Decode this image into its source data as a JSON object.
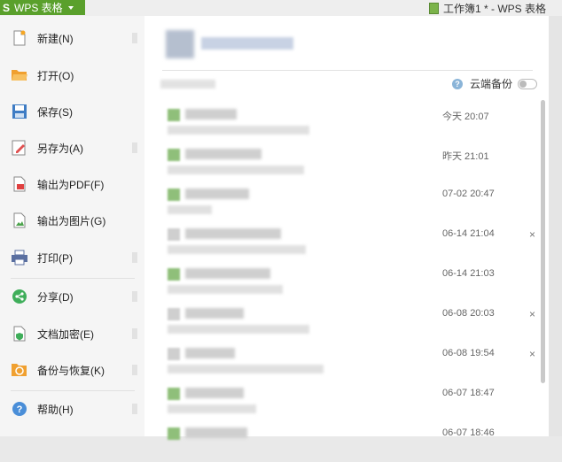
{
  "app": {
    "logo": "S",
    "name": "WPS 表格",
    "doc_title": "工作簿1 * - WPS 表格"
  },
  "menu": [
    {
      "label": "新建(N)",
      "icon": "new-doc-icon",
      "arrow": true
    },
    {
      "label": "打开(O)",
      "icon": "folder-open-icon",
      "arrow": false
    },
    {
      "label": "保存(S)",
      "icon": "save-icon",
      "arrow": false
    },
    {
      "label": "另存为(A)",
      "icon": "save-as-icon",
      "arrow": true
    },
    {
      "label": "输出为PDF(F)",
      "icon": "pdf-icon",
      "arrow": false
    },
    {
      "label": "输出为图片(G)",
      "icon": "image-export-icon",
      "arrow": false
    },
    {
      "label": "打印(P)",
      "icon": "print-icon",
      "arrow": true
    },
    {
      "label": "分享(D)",
      "icon": "share-icon",
      "arrow": true
    },
    {
      "label": "文档加密(E)",
      "icon": "encrypt-icon",
      "arrow": true
    },
    {
      "label": "备份与恢复(K)",
      "icon": "backup-icon",
      "arrow": true
    },
    {
      "label": "帮助(H)",
      "icon": "help-icon",
      "arrow": true
    }
  ],
  "cloud_backup": {
    "label": "云端备份",
    "enabled": false
  },
  "recent_files": [
    {
      "time": "今天 20:07",
      "close": ""
    },
    {
      "time": "昨天 21:01",
      "close": ""
    },
    {
      "time": "07-02 20:47",
      "close": ""
    },
    {
      "time": "06-14 21:04",
      "close": "×"
    },
    {
      "time": "06-14 21:03",
      "close": ""
    },
    {
      "time": "06-08 20:03",
      "close": "×"
    },
    {
      "time": "06-08 19:54",
      "close": "×"
    },
    {
      "time": "06-07 18:47",
      "close": ""
    },
    {
      "time": "06-07 18:46",
      "close": ""
    }
  ],
  "colors": {
    "accent": "#5aa02c",
    "menu_bg": "#f5f5f5",
    "panel_bg": "#ffffff"
  }
}
